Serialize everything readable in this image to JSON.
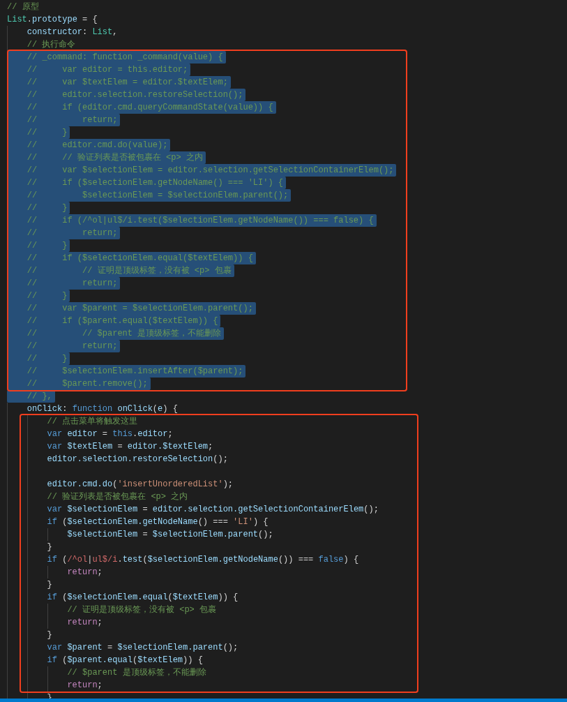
{
  "editor": {
    "lines": [
      {
        "boxed": false,
        "selected": false,
        "tokens": [
          {
            "kind": "comment",
            "text": "// 原型"
          }
        ]
      },
      {
        "boxed": false,
        "selected": false,
        "tokens": [
          {
            "kind": "type",
            "text": "List"
          },
          {
            "kind": "plain",
            "text": "."
          },
          {
            "kind": "identifier",
            "text": "prototype"
          },
          {
            "kind": "plain",
            "text": " = {"
          }
        ],
        "children": [
          {
            "boxed": false,
            "selected": false,
            "tokens": [
              {
                "kind": "identifier",
                "text": "constructor"
              },
              {
                "kind": "plain",
                "text": ": "
              },
              {
                "kind": "type",
                "text": "List"
              },
              {
                "kind": "plain",
                "text": ","
              }
            ]
          },
          {
            "boxed": false,
            "selected": false,
            "tokens": [
              {
                "kind": "comment",
                "text": "// 执行命令"
              }
            ]
          },
          {
            "boxed": true,
            "selected": true,
            "tokens": [
              {
                "kind": "comment",
                "text": "// _command: function _command(value) {"
              }
            ]
          },
          {
            "boxed": true,
            "selected": true,
            "tokens": [
              {
                "kind": "comment",
                "text": "//     var editor = this.editor;"
              }
            ]
          },
          {
            "boxed": true,
            "selected": true,
            "tokens": [
              {
                "kind": "comment",
                "text": "//     var $textElem = editor.$textElem;"
              }
            ]
          },
          {
            "boxed": true,
            "selected": true,
            "tokens": [
              {
                "kind": "comment",
                "text": "//     editor.selection.restoreSelection();"
              }
            ]
          },
          {
            "boxed": true,
            "selected": true,
            "tokens": [
              {
                "kind": "comment",
                "text": "//     if (editor.cmd.queryCommandState(value)) {"
              }
            ]
          },
          {
            "boxed": true,
            "selected": true,
            "tokens": [
              {
                "kind": "comment",
                "text": "//         return;"
              }
            ]
          },
          {
            "boxed": true,
            "selected": true,
            "tokens": [
              {
                "kind": "comment",
                "text": "//     }"
              }
            ]
          },
          {
            "boxed": true,
            "selected": true,
            "tokens": [
              {
                "kind": "comment",
                "text": "//     editor.cmd.do(value);"
              }
            ]
          },
          {
            "boxed": true,
            "selected": true,
            "tokens": [
              {
                "kind": "comment",
                "text": "//     // 验证列表是否被包裹在 <p> 之内"
              }
            ]
          },
          {
            "boxed": true,
            "selected": true,
            "tokens": [
              {
                "kind": "comment",
                "text": "//     var $selectionElem = editor.selection.getSelectionContainerElem();"
              }
            ]
          },
          {
            "boxed": true,
            "selected": true,
            "tokens": [
              {
                "kind": "comment",
                "text": "//     if ($selectionElem.getNodeName() === 'LI') {"
              }
            ]
          },
          {
            "boxed": true,
            "selected": true,
            "tokens": [
              {
                "kind": "comment",
                "text": "//         $selectionElem = $selectionElem.parent();"
              }
            ]
          },
          {
            "boxed": true,
            "selected": true,
            "tokens": [
              {
                "kind": "comment",
                "text": "//     }"
              }
            ]
          },
          {
            "boxed": true,
            "selected": true,
            "tokens": [
              {
                "kind": "comment",
                "text": "//     if (/^ol|ul$/i.test($selectionElem.getNodeName()) === false) {"
              }
            ]
          },
          {
            "boxed": true,
            "selected": true,
            "tokens": [
              {
                "kind": "comment",
                "text": "//         return;"
              }
            ]
          },
          {
            "boxed": true,
            "selected": true,
            "tokens": [
              {
                "kind": "comment",
                "text": "//     }"
              }
            ]
          },
          {
            "boxed": true,
            "selected": true,
            "tokens": [
              {
                "kind": "comment",
                "text": "//     if ($selectionElem.equal($textElem)) {"
              }
            ]
          },
          {
            "boxed": true,
            "selected": true,
            "tokens": [
              {
                "kind": "comment",
                "text": "//         // 证明是顶级标签，没有被 <p> 包裹"
              }
            ]
          },
          {
            "boxed": true,
            "selected": true,
            "tokens": [
              {
                "kind": "comment",
                "text": "//         return;"
              }
            ]
          },
          {
            "boxed": true,
            "selected": true,
            "tokens": [
              {
                "kind": "comment",
                "text": "//     }"
              }
            ]
          },
          {
            "boxed": true,
            "selected": true,
            "tokens": [
              {
                "kind": "comment",
                "text": "//     var $parent = $selectionElem.parent();"
              }
            ]
          },
          {
            "boxed": true,
            "selected": true,
            "tokens": [
              {
                "kind": "comment",
                "text": "//     if ($parent.equal($textElem)) {"
              }
            ]
          },
          {
            "boxed": true,
            "selected": true,
            "tokens": [
              {
                "kind": "comment",
                "text": "//         // $parent 是顶级标签，不能删除"
              }
            ]
          },
          {
            "boxed": true,
            "selected": true,
            "tokens": [
              {
                "kind": "comment",
                "text": "//         return;"
              }
            ]
          },
          {
            "boxed": true,
            "selected": true,
            "tokens": [
              {
                "kind": "comment",
                "text": "//     }"
              }
            ]
          },
          {
            "boxed": true,
            "selected": true,
            "tokens": [
              {
                "kind": "comment",
                "text": "//     $selectionElem.insertAfter($parent);"
              }
            ]
          },
          {
            "boxed": true,
            "selected": true,
            "tokens": [
              {
                "kind": "comment",
                "text": "//     $parent.remove();"
              }
            ]
          },
          {
            "boxed": false,
            "selected": true,
            "tokens": [
              {
                "kind": "comment",
                "text": "// },"
              }
            ]
          },
          {
            "boxed": false,
            "selected": false,
            "tokens": [
              {
                "kind": "identifier",
                "text": "onClick"
              },
              {
                "kind": "plain",
                "text": ": "
              },
              {
                "kind": "keyword",
                "text": "function "
              },
              {
                "kind": "identifier",
                "text": "onClick"
              },
              {
                "kind": "plain",
                "text": "("
              },
              {
                "kind": "identifier",
                "text": "e"
              },
              {
                "kind": "plain",
                "text": ") {"
              }
            ],
            "children": [
              {
                "boxed": true,
                "selected": false,
                "tokens": [
                  {
                    "kind": "comment",
                    "text": "// 点击菜单将触发这里"
                  }
                ]
              },
              {
                "boxed": true,
                "selected": false,
                "tokens": [
                  {
                    "kind": "keyword",
                    "text": "var "
                  },
                  {
                    "kind": "identifier",
                    "text": "editor"
                  },
                  {
                    "kind": "plain",
                    "text": " = "
                  },
                  {
                    "kind": "keyword",
                    "text": "this"
                  },
                  {
                    "kind": "plain",
                    "text": "."
                  },
                  {
                    "kind": "identifier",
                    "text": "editor"
                  },
                  {
                    "kind": "plain",
                    "text": ";"
                  }
                ]
              },
              {
                "boxed": true,
                "selected": false,
                "tokens": [
                  {
                    "kind": "keyword",
                    "text": "var "
                  },
                  {
                    "kind": "identifier",
                    "text": "$textElem"
                  },
                  {
                    "kind": "plain",
                    "text": " = "
                  },
                  {
                    "kind": "identifier",
                    "text": "editor.$textElem"
                  },
                  {
                    "kind": "plain",
                    "text": ";"
                  }
                ]
              },
              {
                "boxed": true,
                "selected": false,
                "tokens": [
                  {
                    "kind": "identifier",
                    "text": "editor.selection.restoreSelection"
                  },
                  {
                    "kind": "plain",
                    "text": "();"
                  }
                ]
              },
              {
                "boxed": true,
                "selected": false
              },
              {
                "boxed": true,
                "selected": false,
                "tokens": [
                  {
                    "kind": "identifier",
                    "text": "editor.cmd.do"
                  },
                  {
                    "kind": "plain",
                    "text": "("
                  },
                  {
                    "kind": "string",
                    "text": "'insertUnorderedList'"
                  },
                  {
                    "kind": "plain",
                    "text": ");"
                  }
                ]
              },
              {
                "boxed": true,
                "selected": false,
                "tokens": [
                  {
                    "kind": "comment",
                    "text": "// 验证列表是否被包裹在 <p> 之内"
                  }
                ]
              },
              {
                "boxed": true,
                "selected": false,
                "tokens": [
                  {
                    "kind": "keyword",
                    "text": "var "
                  },
                  {
                    "kind": "identifier",
                    "text": "$selectionElem"
                  },
                  {
                    "kind": "plain",
                    "text": " = "
                  },
                  {
                    "kind": "identifier",
                    "text": "editor.selection.getSelectionContainerElem"
                  },
                  {
                    "kind": "plain",
                    "text": "();"
                  }
                ]
              },
              {
                "boxed": true,
                "selected": false,
                "tokens": [
                  {
                    "kind": "keyword",
                    "text": "if"
                  },
                  {
                    "kind": "plain",
                    "text": " ("
                  },
                  {
                    "kind": "identifier",
                    "text": "$selectionElem.getNodeName"
                  },
                  {
                    "kind": "plain",
                    "text": "() === "
                  },
                  {
                    "kind": "string",
                    "text": "'LI'"
                  },
                  {
                    "kind": "plain",
                    "text": ") {"
                  }
                ],
                "children": [
                  {
                    "boxed": true,
                    "selected": false,
                    "tokens": [
                      {
                        "kind": "identifier",
                        "text": "$selectionElem"
                      },
                      {
                        "kind": "plain",
                        "text": " = "
                      },
                      {
                        "kind": "identifier",
                        "text": "$selectionElem.parent"
                      },
                      {
                        "kind": "plain",
                        "text": "();"
                      }
                    ]
                  }
                ]
              },
              {
                "boxed": true,
                "selected": false,
                "tokens": [
                  {
                    "kind": "plain",
                    "text": "}"
                  }
                ]
              },
              {
                "boxed": true,
                "selected": false,
                "tokens": [
                  {
                    "kind": "keyword",
                    "text": "if"
                  },
                  {
                    "kind": "plain",
                    "text": " ("
                  },
                  {
                    "kind": "regex",
                    "text": "/^ol"
                  },
                  {
                    "kind": "plain",
                    "text": "|"
                  },
                  {
                    "kind": "regex",
                    "text": "ul$/i"
                  },
                  {
                    "kind": "plain",
                    "text": "."
                  },
                  {
                    "kind": "identifier",
                    "text": "test"
                  },
                  {
                    "kind": "plain",
                    "text": "("
                  },
                  {
                    "kind": "identifier",
                    "text": "$selectionElem.getNodeName"
                  },
                  {
                    "kind": "plain",
                    "text": "()) === "
                  },
                  {
                    "kind": "keyword",
                    "text": "false"
                  },
                  {
                    "kind": "plain",
                    "text": ") {"
                  }
                ],
                "children": [
                  {
                    "boxed": true,
                    "selected": false,
                    "tokens": [
                      {
                        "kind": "control",
                        "text": "return"
                      },
                      {
                        "kind": "plain",
                        "text": ";"
                      }
                    ]
                  }
                ]
              },
              {
                "boxed": true,
                "selected": false,
                "tokens": [
                  {
                    "kind": "plain",
                    "text": "}"
                  }
                ]
              },
              {
                "boxed": true,
                "selected": false,
                "tokens": [
                  {
                    "kind": "keyword",
                    "text": "if"
                  },
                  {
                    "kind": "plain",
                    "text": " ("
                  },
                  {
                    "kind": "identifier",
                    "text": "$selectionElem.equal"
                  },
                  {
                    "kind": "plain",
                    "text": "("
                  },
                  {
                    "kind": "identifier",
                    "text": "$textElem"
                  },
                  {
                    "kind": "plain",
                    "text": ")) {"
                  }
                ],
                "children": [
                  {
                    "boxed": true,
                    "selected": false,
                    "tokens": [
                      {
                        "kind": "comment",
                        "text": "// 证明是顶级标签，没有被 <p> 包裹"
                      }
                    ]
                  },
                  {
                    "boxed": true,
                    "selected": false,
                    "tokens": [
                      {
                        "kind": "control",
                        "text": "return"
                      },
                      {
                        "kind": "plain",
                        "text": ";"
                      }
                    ]
                  }
                ]
              },
              {
                "boxed": true,
                "selected": false,
                "tokens": [
                  {
                    "kind": "plain",
                    "text": "}"
                  }
                ]
              },
              {
                "boxed": true,
                "selected": false,
                "tokens": [
                  {
                    "kind": "keyword",
                    "text": "var "
                  },
                  {
                    "kind": "identifier",
                    "text": "$parent"
                  },
                  {
                    "kind": "plain",
                    "text": " = "
                  },
                  {
                    "kind": "identifier",
                    "text": "$selectionElem.parent"
                  },
                  {
                    "kind": "plain",
                    "text": "();"
                  }
                ]
              },
              {
                "boxed": true,
                "selected": false,
                "tokens": [
                  {
                    "kind": "keyword",
                    "text": "if"
                  },
                  {
                    "kind": "plain",
                    "text": " ("
                  },
                  {
                    "kind": "identifier",
                    "text": "$parent.equal"
                  },
                  {
                    "kind": "plain",
                    "text": "("
                  },
                  {
                    "kind": "identifier",
                    "text": "$textElem"
                  },
                  {
                    "kind": "plain",
                    "text": ")) {"
                  }
                ],
                "children": [
                  {
                    "boxed": true,
                    "selected": false,
                    "tokens": [
                      {
                        "kind": "comment",
                        "text": "// $parent 是顶级标签，不能删除"
                      }
                    ]
                  },
                  {
                    "boxed": true,
                    "selected": false,
                    "tokens": [
                      {
                        "kind": "control",
                        "text": "return"
                      },
                      {
                        "kind": "plain",
                        "text": ";"
                      }
                    ]
                  }
                ]
              },
              {
                "boxed": false,
                "selected": false,
                "tokens": [
                  {
                    "kind": "plain",
                    "text": "}"
                  }
                ]
              }
            ]
          }
        ]
      }
    ]
  }
}
